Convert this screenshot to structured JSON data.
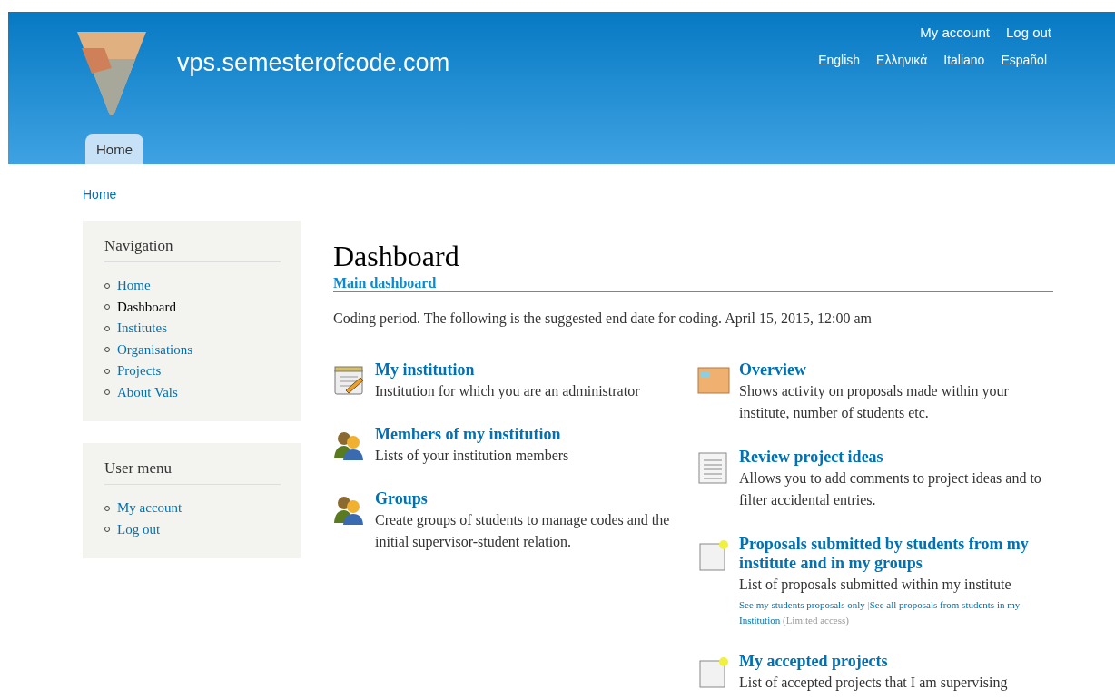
{
  "site": {
    "name": "vps.semesterofcode.com"
  },
  "secondary_menu": [
    {
      "label": "My account"
    },
    {
      "label": "Log out"
    }
  ],
  "languages": [
    {
      "label": "English"
    },
    {
      "label": "Ελληνικά"
    },
    {
      "label": "Italiano"
    },
    {
      "label": "Español"
    }
  ],
  "main_tabs": [
    {
      "label": "Home",
      "selected": true
    }
  ],
  "breadcrumb": "Home",
  "sidebar": [
    {
      "title": "Navigation",
      "items": [
        {
          "label": "Home",
          "selected": false
        },
        {
          "label": "Dashboard",
          "selected": true
        },
        {
          "label": "Institutes",
          "selected": false
        },
        {
          "label": "Organisations",
          "selected": false
        },
        {
          "label": "Projects",
          "selected": false
        },
        {
          "label": "About Vals",
          "selected": false
        }
      ]
    },
    {
      "title": "User menu",
      "items": [
        {
          "label": "My account",
          "selected": false
        },
        {
          "label": "Log out",
          "selected": false
        }
      ]
    }
  ],
  "page_title": "Dashboard",
  "section_tab": "Main dashboard",
  "notice": "Coding period. The following is the suggested end date for coding. April 15, 2015, 12:00 am",
  "columns": [
    [
      {
        "kind": "notepad",
        "title": "My institution",
        "description": "Institution for which you are an administrator"
      },
      {
        "kind": "people",
        "title": "Members of my institution",
        "description": "Lists of your institution members"
      },
      {
        "kind": "people",
        "title": "Groups",
        "description": "Create groups of students to manage codes and the initial supervisor-student relation."
      }
    ],
    [
      {
        "kind": "folder",
        "title": "Overview",
        "description": "Shows activity on proposals made within your institute, number of students etc."
      },
      {
        "kind": "document",
        "title": "Review project ideas",
        "description": "Allows you to add comments to project ideas and to filter accidental entries."
      },
      {
        "kind": "document-new",
        "title": "Proposals submitted by students from my institute and in my groups",
        "description": "List of proposals submitted within my institute",
        "links": [
          "See my students proposals only",
          "See all proposals from students in my Institution"
        ],
        "separator": "|",
        "note": "(Limited access)"
      },
      {
        "kind": "document-new",
        "title": "My accepted projects",
        "description": "List of accepted projects that I am supervising"
      }
    ]
  ]
}
